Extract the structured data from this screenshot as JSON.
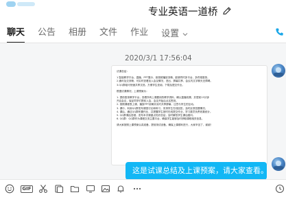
{
  "window": {
    "title": "专业英语一道桥"
  },
  "tabs": [
    {
      "label": "聊天",
      "active": true
    },
    {
      "label": "公告",
      "active": false
    },
    {
      "label": "相册",
      "active": false
    },
    {
      "label": "文件",
      "active": false
    },
    {
      "label": "作业",
      "active": false
    },
    {
      "label": "设置",
      "active": false
    }
  ],
  "chat": {
    "timestamp": "2020/3/1 17:56:04",
    "document_message": {
      "lines": [
        "试课总结：",
        "",
        "1.智能教学平台、直播、PPT展示、音视频播放流畅，能够同时多平台、多终端登录。",
        "2.通讯及交流畅，可实时查看加入会议情况，进出、屏幕共享、会议内文字聊天无障碍。",
        "3.QQ群组可快速共享文档，方便学生查阅、下载及提交作业。",
        "",
        "根据试课情况，上课预案为：",
        "",
        "1. 提前登录教学平台，查看所有上课要用的教学资料，确认直播效果，并提前15分钟",
        "   开启会议，保证同学们提前入会，会议开始后点名签到。",
        "2. 按照课程表上课，播放PPT讲解并实时共享屏幕，注意与学生的互动。",
        "3. 课中，利用QQ群发布课堂讨论和练习，安排学生在线回答，及时反馈答题情况。",
        "4. 课后，通过QQ群布置作业，并提醒学生按时在线提交作业，学习委员负责收集统计。",
        "5. QQ群课后答疑，发布本次课重点知识总结，及时解答学生课后疑问。",
        "6. QQ群：QQ群作为课程交流主要平台，确保学生能够及时获取课程相关信息。",
        "",
        "请大家按照上课预案认真准备，提前测试设备，确保上课顺利进行，大家辛苦了，谢谢！"
      ]
    },
    "text_message": {
      "text": "这是试课总结及上课预案，请大家查看。"
    }
  },
  "icons": {
    "edit": "pencil-icon",
    "settings_dropdown": "chevron-down-icon",
    "call": "phone-icon",
    "toolbar": [
      "emoji-icon",
      "gif-icon",
      "scissors-icon",
      "file-icon",
      "folder-icon",
      "screen-icon",
      "image-icon",
      "bell-icon",
      "more-icon",
      "history-icon"
    ]
  },
  "toolbar": {
    "gif_label": "GIF"
  },
  "colors": {
    "bubble_bg": "#12b7f5",
    "chat_bg": "#f5f6f7",
    "call_icon": "#1aa7e8"
  }
}
